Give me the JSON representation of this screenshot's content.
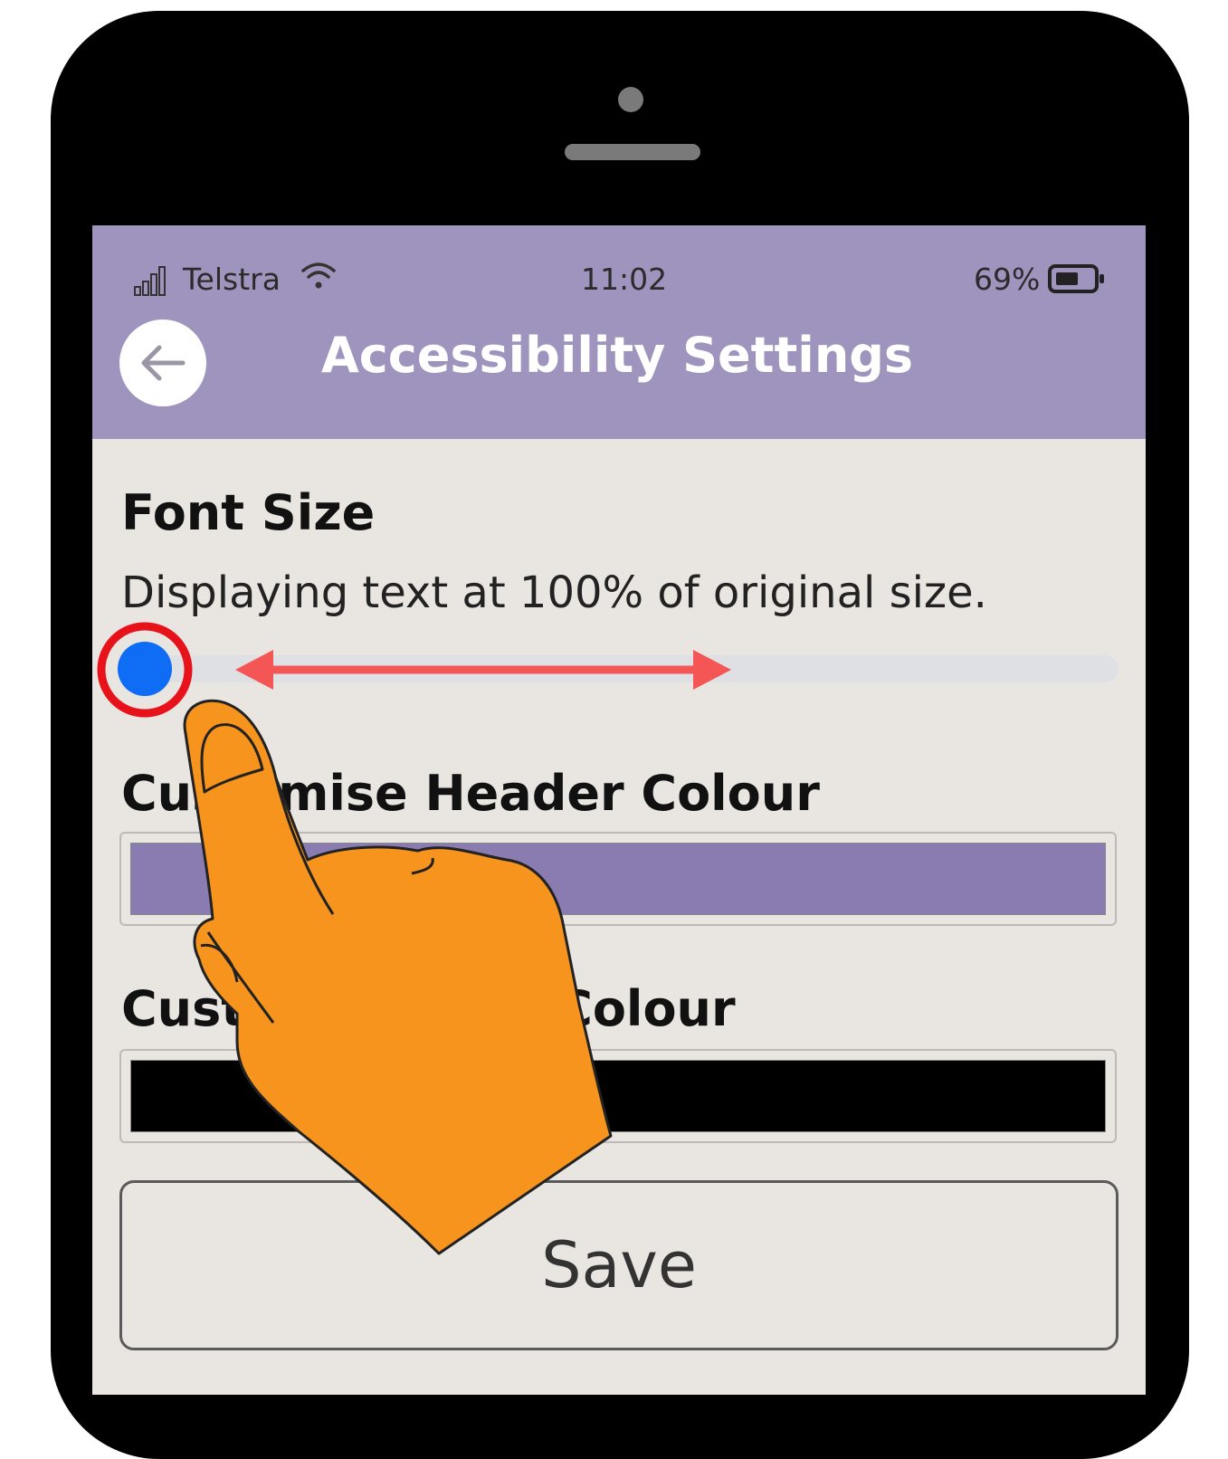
{
  "status_bar": {
    "carrier": "Telstra",
    "time": "11:02",
    "battery": "69%"
  },
  "header": {
    "title": "Accessibility Settings",
    "color": "#9e94bd"
  },
  "font_size": {
    "title": "Font Size",
    "description": "Displaying text at 100% of original size.",
    "slider_value_fraction": 0.0
  },
  "header_colour": {
    "title": "Customise Header Colour",
    "swatch_color": "#8a7bb0"
  },
  "text_colour": {
    "title": "Customise Text Colour",
    "swatch_color": "#000000"
  },
  "save_label": "Save",
  "icons": {
    "back": "arrow-left-icon",
    "signal": "signal-icon",
    "wifi": "wifi-icon",
    "battery": "battery-icon"
  },
  "overlay_colors": {
    "highlight_ring": "#e8121a",
    "drag_arrow": "#f45656",
    "hand": "#f7941d"
  }
}
